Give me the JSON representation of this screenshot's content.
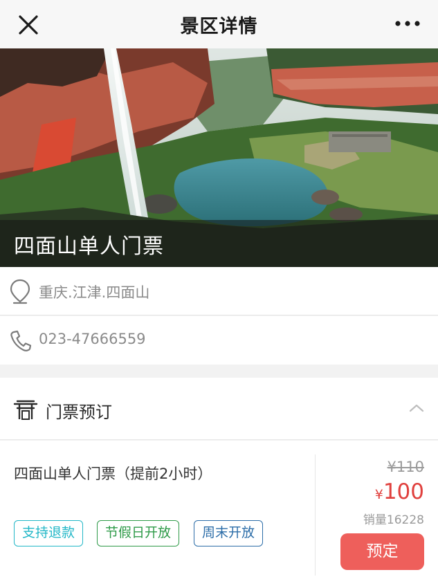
{
  "navbar": {
    "title": "景区详情",
    "close_icon": "close-icon",
    "more_icon": "more-icon"
  },
  "hero": {
    "title": "四面山单人门票"
  },
  "info": {
    "address": "重庆.江津.四面山",
    "phone": "023-47666559",
    "address_icon": "location-pin-icon",
    "phone_icon": "phone-icon"
  },
  "section": {
    "label": "门票预订",
    "icon": "gate-icon",
    "toggle_icon": "chevron-up-icon"
  },
  "ticket": {
    "name": "四面山单人门票（提前2小时）",
    "tags": [
      "支持退款",
      "节假日开放",
      "周末开放"
    ],
    "old_price": "¥110",
    "currency": "¥",
    "price": "100",
    "sales": "销量16228",
    "book_label": "预定"
  },
  "colors": {
    "accent_red": "#e0403d",
    "button_red": "#ee5f5b",
    "tag_cyan": "#22b7c7",
    "tag_green": "#2e9a48",
    "tag_blue": "#2c6da8"
  }
}
